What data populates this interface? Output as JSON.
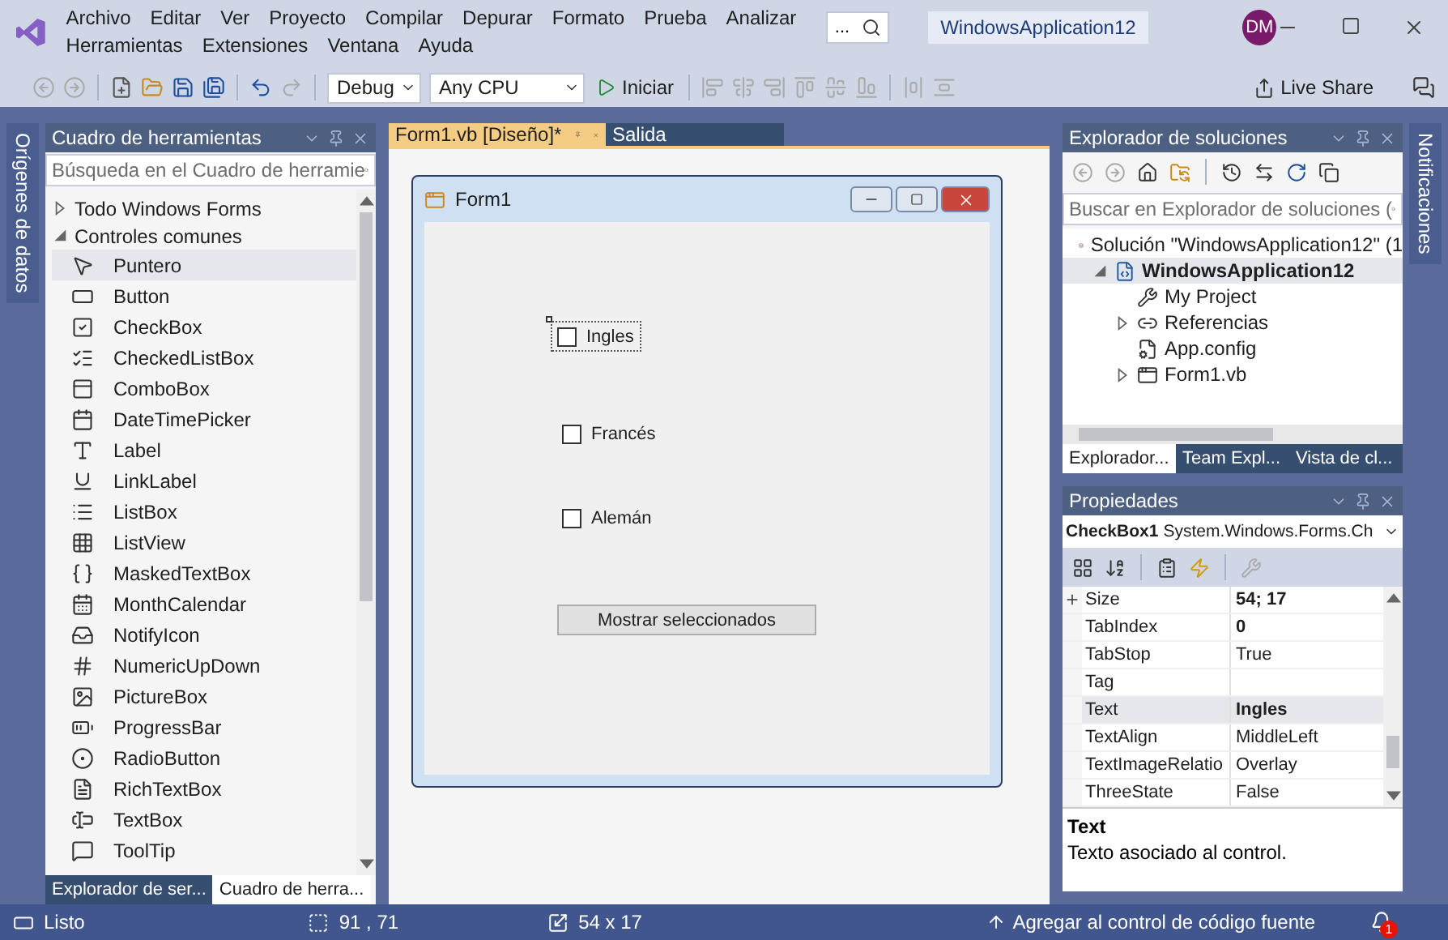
{
  "window": {
    "menu": [
      "Archivo",
      "Editar",
      "Ver",
      "Proyecto",
      "Compilar",
      "Depurar",
      "Formato",
      "Prueba",
      "Analizar",
      "Herramientas",
      "Extensiones",
      "Ventana",
      "Ayuda"
    ],
    "search": "...",
    "title": "WindowsApplication12",
    "avatar": "DM"
  },
  "toolbar": {
    "configuration": "Debug",
    "platform": "Any CPU",
    "start": "Iniciar",
    "live_share": "Live Share"
  },
  "left_strip": "Orígenes de datos",
  "toolbox": {
    "title": "Cuadro de herramientas",
    "search_placeholder": "Búsqueda en el Cuadro de herramie",
    "groups": [
      {
        "label": "Todo Windows Forms",
        "expanded": false
      },
      {
        "label": "Controles comunes",
        "expanded": true,
        "children": [
          {
            "label": "Puntero",
            "selected": true
          },
          {
            "label": "Button",
            "selected": false
          },
          {
            "label": "CheckBox",
            "selected": false
          },
          {
            "label": "CheckedListBox",
            "selected": false
          },
          {
            "label": "ComboBox",
            "selected": false
          },
          {
            "label": "DateTimePicker",
            "selected": false
          },
          {
            "label": "Label",
            "selected": false
          },
          {
            "label": "LinkLabel",
            "selected": false
          },
          {
            "label": "ListBox",
            "selected": false
          },
          {
            "label": "ListView",
            "selected": false
          },
          {
            "label": "MaskedTextBox",
            "selected": false
          },
          {
            "label": "MonthCalendar",
            "selected": false
          },
          {
            "label": "NotifyIcon",
            "selected": false
          },
          {
            "label": "NumericUpDown",
            "selected": false
          },
          {
            "label": "PictureBox",
            "selected": false
          },
          {
            "label": "ProgressBar",
            "selected": false
          },
          {
            "label": "RadioButton",
            "selected": false
          },
          {
            "label": "RichTextBox",
            "selected": false
          },
          {
            "label": "TextBox",
            "selected": false
          },
          {
            "label": "ToolTip",
            "selected": false
          }
        ]
      }
    ],
    "tabs": [
      {
        "label": "Explorador de ser...",
        "selected": false
      },
      {
        "label": "Cuadro de herra...",
        "selected": true
      }
    ]
  },
  "editor": {
    "tabs": [
      {
        "label": "Form1.vb [Diseño]*",
        "selected": true
      },
      {
        "label": "Salida",
        "selected": false
      }
    ],
    "form": {
      "title": "Form1",
      "checkboxes": [
        {
          "label": "Ingles",
          "checked": false,
          "selected": true
        },
        {
          "label": "Francés",
          "checked": false,
          "selected": false
        },
        {
          "label": "Alemán",
          "checked": false,
          "selected": false
        }
      ],
      "button": "Mostrar seleccionados"
    }
  },
  "solution_explorer": {
    "title": "Explorador de soluciones",
    "search_placeholder": "Buscar en Explorador de soluciones (",
    "tree": [
      {
        "label": "Solución \"WindowsApplication12\" (1",
        "kind": "solution",
        "selected": false,
        "children": [
          {
            "label": "WindowsApplication12",
            "kind": "project",
            "selected": true,
            "expanded": true,
            "children": [
              {
                "label": "My Project",
                "kind": "settings",
                "selected": false
              },
              {
                "label": "Referencias",
                "kind": "references",
                "selected": false,
                "expanded": false
              },
              {
                "label": "App.config",
                "kind": "config",
                "selected": false
              },
              {
                "label": "Form1.vb",
                "kind": "form",
                "selected": false,
                "expanded": false
              }
            ]
          }
        ]
      }
    ],
    "tabs": [
      {
        "label": "Explorador...",
        "selected": true
      },
      {
        "label": "Team Expl...",
        "selected": false
      },
      {
        "label": "Vista de cl...",
        "selected": false
      }
    ]
  },
  "properties": {
    "title": "Propiedades",
    "object": "CheckBox1",
    "type": "System.Windows.Forms.Ch",
    "rows": [
      {
        "name": "Size",
        "value": "54; 17",
        "modified": true,
        "expandable": true,
        "selected": false
      },
      {
        "name": "TabIndex",
        "value": "0",
        "modified": true,
        "expandable": false,
        "selected": false
      },
      {
        "name": "TabStop",
        "value": "True",
        "modified": false,
        "expandable": false,
        "selected": false
      },
      {
        "name": "Tag",
        "expandable": false,
        "selected": false
      },
      {
        "name": "Text",
        "value": "Ingles",
        "modified": true,
        "expandable": false,
        "selected": true
      },
      {
        "name": "TextAlign",
        "value": "MiddleLeft",
        "modified": false,
        "expandable": false,
        "selected": false
      },
      {
        "name": "TextImageRelatio",
        "value": "Overlay",
        "modified": false,
        "expandable": false,
        "selected": false
      },
      {
        "name": "ThreeState",
        "value": "False",
        "modified": false,
        "expandable": false,
        "selected": false
      }
    ],
    "description_title": "Text",
    "description": "Texto asociado al control."
  },
  "right_strip": "Notificaciones",
  "status_bar": {
    "state": "Listo",
    "position": "91 , 71",
    "size": "54 x 17",
    "source_control": "Agregar al control de código fuente",
    "notifications": "1"
  }
}
